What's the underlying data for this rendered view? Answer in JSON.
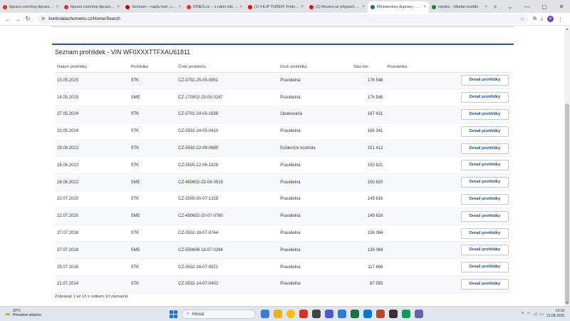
{
  "browser": {
    "tabs": [
      {
        "label": "tipcars.com/muj-tipcars/i...",
        "color": "#d93025"
      },
      {
        "label": "tipcars.com/muj-tipcars/i...",
        "color": "#d93025"
      },
      {
        "label": "Seznam – najdu tam, co z...",
        "color": "#cc0000"
      },
      {
        "label": "iDNES.cz – s námi víte víc...",
        "color": "#e4312b"
      },
      {
        "label": "(1) FILIP TURER: Fridrichu...",
        "color": "#ff0000"
      },
      {
        "label": "(1) Revers se připravil k Ž...",
        "color": "#ff0000"
      },
      {
        "label": "Ministerstvo dopravy - K...",
        "color": "#1f5b9d"
      },
      {
        "label": "repdoc - Hledat vozidlo",
        "color": "#188038"
      }
    ],
    "active_tab": 6,
    "new_tab_label": "+",
    "url": "kontrolatachometru.cz/Home/Search",
    "avatar_letter": "P"
  },
  "page": {
    "title": "Seznam prohlídek - VIN WF0XXXTTFXAU61811",
    "columns": {
      "datum": "Datum prohlídky",
      "provadi": "Prohlídka",
      "cislo": "Číslo protokolu",
      "druh": "Druh prohlídky",
      "stav": "Stav km",
      "poznamka": "Poznámka"
    },
    "button_label": "Detail prohlídky",
    "rows": [
      {
        "datum": "15.05.2025",
        "typ": "STK",
        "cislo": "CZ-3702-25-05-0851",
        "druh": "Pravidelná",
        "stav": "176 548"
      },
      {
        "datum": "14.05.2025",
        "typ": "SME",
        "cislo": "CZ-170902-25-05-0247",
        "druh": "Pravidelná",
        "stav": "176 546"
      },
      {
        "datum": "27.05.2024",
        "typ": "STK",
        "cislo": "CZ-3702-24-05-1636",
        "druh": "Opakovaná",
        "stav": "167 431"
      },
      {
        "datum": "20.05.2024",
        "typ": "STK",
        "cislo": "CZ-3532-24-05-0410",
        "druh": "Pravidelná",
        "stav": "166 341"
      },
      {
        "datum": "29.09.2022",
        "typ": "STK",
        "cislo": "CZ-3532-22-09-0685",
        "druh": "Evidenční kontrola",
        "stav": "151 412"
      },
      {
        "datum": "28.06.2022",
        "typ": "STK",
        "cislo": "CZ-3505-22-06-1826",
        "druh": "Pravidelná",
        "stav": "150 821"
      },
      {
        "datum": "28.06.2022",
        "typ": "SME",
        "cislo": "CZ-450602-22-06-0919",
        "druh": "Pravidelná",
        "stav": "150 820"
      },
      {
        "datum": "22.07.2020",
        "typ": "STK",
        "cislo": "CZ-3505-20-07-1318",
        "druh": "Pravidelná",
        "stav": "145 616"
      },
      {
        "datum": "22.07.2020",
        "typ": "SME",
        "cislo": "CZ-450602-20-07-0780",
        "druh": "Pravidelná",
        "stav": "145 616"
      },
      {
        "datum": "27.07.2018",
        "typ": "STK",
        "cislo": "CZ-3532-18-07-0744",
        "druh": "Pravidelná",
        "stav": "136 084"
      },
      {
        "datum": "27.07.2018",
        "typ": "SME",
        "cislo": "CZ-550608-18-07-0294",
        "druh": "Pravidelná",
        "stav": "136 084"
      },
      {
        "datum": "25.07.2016",
        "typ": "STK",
        "cislo": "CZ-3532-16-07-0521",
        "druh": "Pravidelná",
        "stav": "117 668"
      },
      {
        "datum": "21.07.2014",
        "typ": "STK",
        "cislo": "CZ-3532-14-07-0402",
        "druh": "Pravidelná",
        "stav": "87 593"
      }
    ],
    "footer": "Zobrazuji 1 až 13 z celkem 13 záznamů"
  },
  "taskbar": {
    "weather_temp": "23°C",
    "weather_desc": "Převážně oblačno",
    "search_placeholder": "Hledat",
    "time": "14:18",
    "date": "22.08.2025"
  }
}
